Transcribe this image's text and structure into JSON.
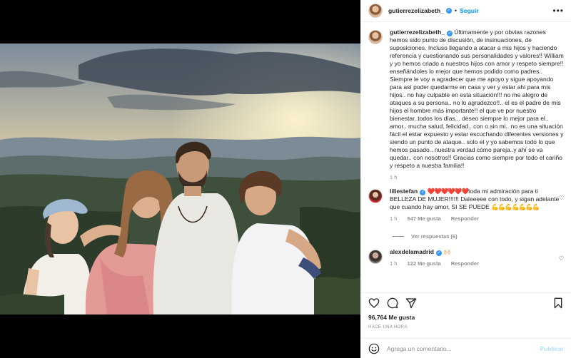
{
  "header": {
    "username": "gutierrezelizabeth_",
    "separator": "•",
    "follow_label": "Seguir",
    "more_label": "•••"
  },
  "caption": {
    "username": "gutierrezelizabeth_",
    "text": "Últimamente y por obvias razones hemos sido punto de discusión, de insinuaciones, de suposiciones. Incluso llegando a atacar a mis hijos y haciendo referencia y cuestionando sus personalidades y valores!! William y yo hemos criado a nuestros hijos con amor y respeto siempre!! enseñándoles lo mejor que hemos podido como padres.. Siempre le voy a agradecer que me apoyo y sigue apoyando para así poder quedarme en casa y ver y estar ahí para mis hijos.. no hay culpable en esta situación!!! no me alegro de ataques a su persona.. no lo agradezco!!.. el es el padre de mis hijos el hombre más importante!! el que ve por nuestro bienestar..todos los días... deseo siempre lo mejor para el.. amor.. mucha salud, felicidad.. con o sin mi.. no es una situación fácil el estar expuesto y estar escuchando diferentes versiones y siendo un punto de ataque.. solo el y yo sabemos todo lo que hemos pasado.. nuestra verdad cómo pareja..y ahí se va quedar.. con nosotros!! Gracias como siempre por todo el cariño y respeto a nuestra familia!!",
    "time": "1 h"
  },
  "comments": [
    {
      "username": "liliestefan",
      "hearts": "❤️❤️❤️❤️❤️❤️",
      "text": "toda mi admiración para ti BELLEZA DE MUJER!!!!!! Daleeeee con todo, y sigan adelante que cuando hay amor, SI SE PUEDE",
      "muscles": "💪💪💪💪💪💪💪",
      "time": "1 h",
      "likes": "547 Me gusta",
      "reply": "Responder",
      "view_replies": "Ver respuestas (6)"
    },
    {
      "username": "alexdelamadrid",
      "text": "🙌🏻",
      "time": "1 h",
      "likes": "122 Me gusta",
      "reply": "Responder"
    }
  ],
  "stats": {
    "likes": "96,764 Me gusta",
    "posted": "HACE UNA HORA"
  },
  "composer": {
    "placeholder": "Agrega un comentario...",
    "post_label": "Publicar"
  },
  "icons": {
    "heart": "heart-icon",
    "comment": "comment-icon",
    "share": "share-icon",
    "bookmark": "bookmark-icon",
    "emoji": "emoji-icon"
  },
  "colors": {
    "accent": "#0095f6",
    "verified": "#3897f0",
    "muted": "#8e8e8e",
    "post_disabled": "#b2dffc"
  }
}
